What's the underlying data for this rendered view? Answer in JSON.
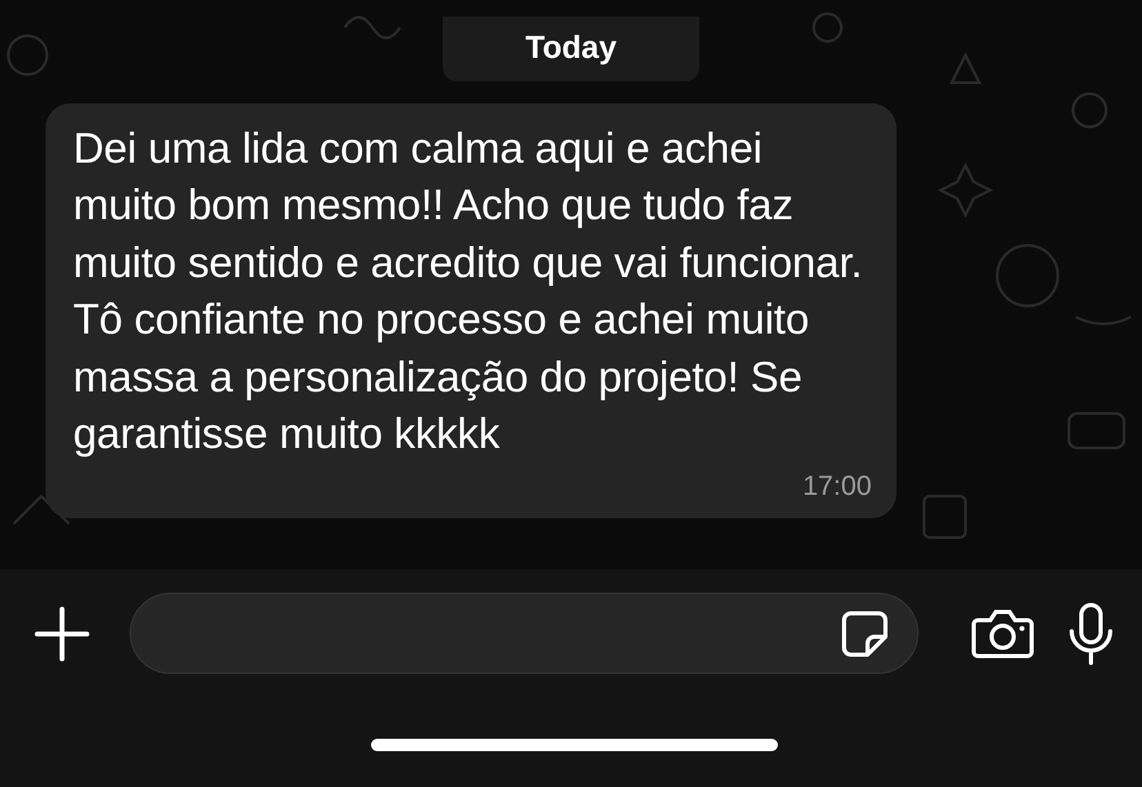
{
  "date_divider": "Today",
  "messages": [
    {
      "text": "Dei uma lida com calma aqui e achei muito bom mesmo!! Acho que tudo faz muito sentido e acredito que vai funcionar. Tô confiante no processo e achei muito massa a personalização do projeto! Se garantisse muito kkkkk",
      "time": "17:00"
    }
  ]
}
